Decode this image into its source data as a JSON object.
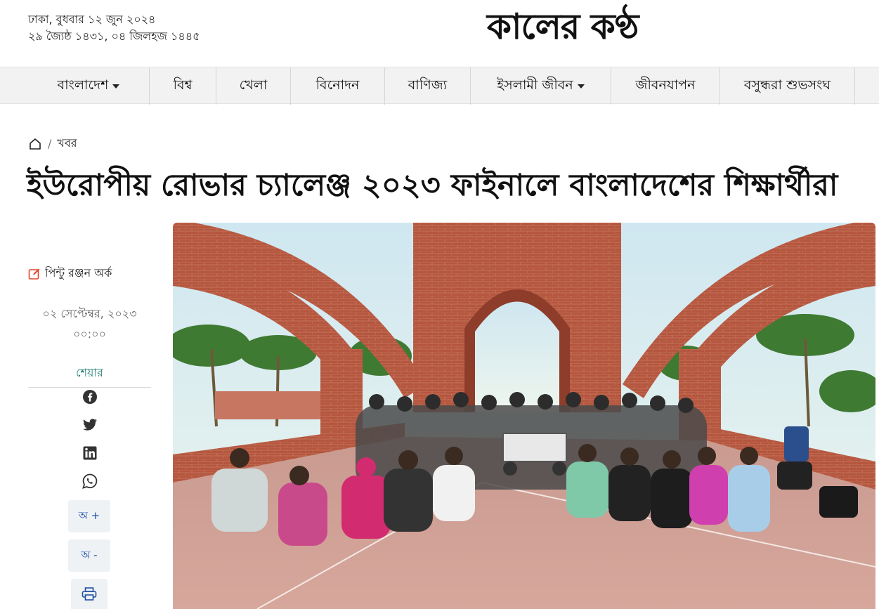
{
  "header": {
    "date_line1": "ঢাকা, বুধবার ১২ জুন ২০২৪",
    "date_line2": "২৯ জ্যৈষ্ঠ ১৪৩১, ০৪ জিলহজ ১৪৪৫",
    "logo_text": "কালের কণ্ঠ"
  },
  "nav": {
    "items": [
      {
        "label": "বাংলাদেশ",
        "has_dropdown": true
      },
      {
        "label": "বিশ্ব",
        "has_dropdown": false
      },
      {
        "label": "খেলা",
        "has_dropdown": false
      },
      {
        "label": "বিনোদন",
        "has_dropdown": false
      },
      {
        "label": "বাণিজ্য",
        "has_dropdown": false
      },
      {
        "label": "ইসলামী জীবন",
        "has_dropdown": true
      },
      {
        "label": "জীবনযাপন",
        "has_dropdown": false
      },
      {
        "label": "বসুন্ধরা শুভসংঘ",
        "has_dropdown": false
      }
    ]
  },
  "breadcrumb": {
    "home_icon": "home-icon",
    "separator": "/",
    "section": "খবর"
  },
  "article": {
    "title": "ইউরোপীয় রোভার চ্যালেঞ্জ ২০২৩ ফাইনালে বাংলাদেশের শিক্ষার্থীরা",
    "author": "পিন্টু রঞ্জন অর্ক",
    "date": "০২ সেপ্টেম্বর, ২০২৩",
    "time": "০০:০০"
  },
  "share": {
    "label": "শেয়ার",
    "icons": [
      "facebook-icon",
      "twitter-icon",
      "linkedin-icon",
      "whatsapp-icon"
    ]
  },
  "tools": {
    "font_increase": "অ +",
    "font_decrease": "অ -",
    "print_icon": "print-icon"
  },
  "colors": {
    "accent_green": "#1a7a6d",
    "edit_icon_red": "#e0452f",
    "nav_bg": "#f2f2f2",
    "tool_text_blue": "#1f4fa3"
  }
}
